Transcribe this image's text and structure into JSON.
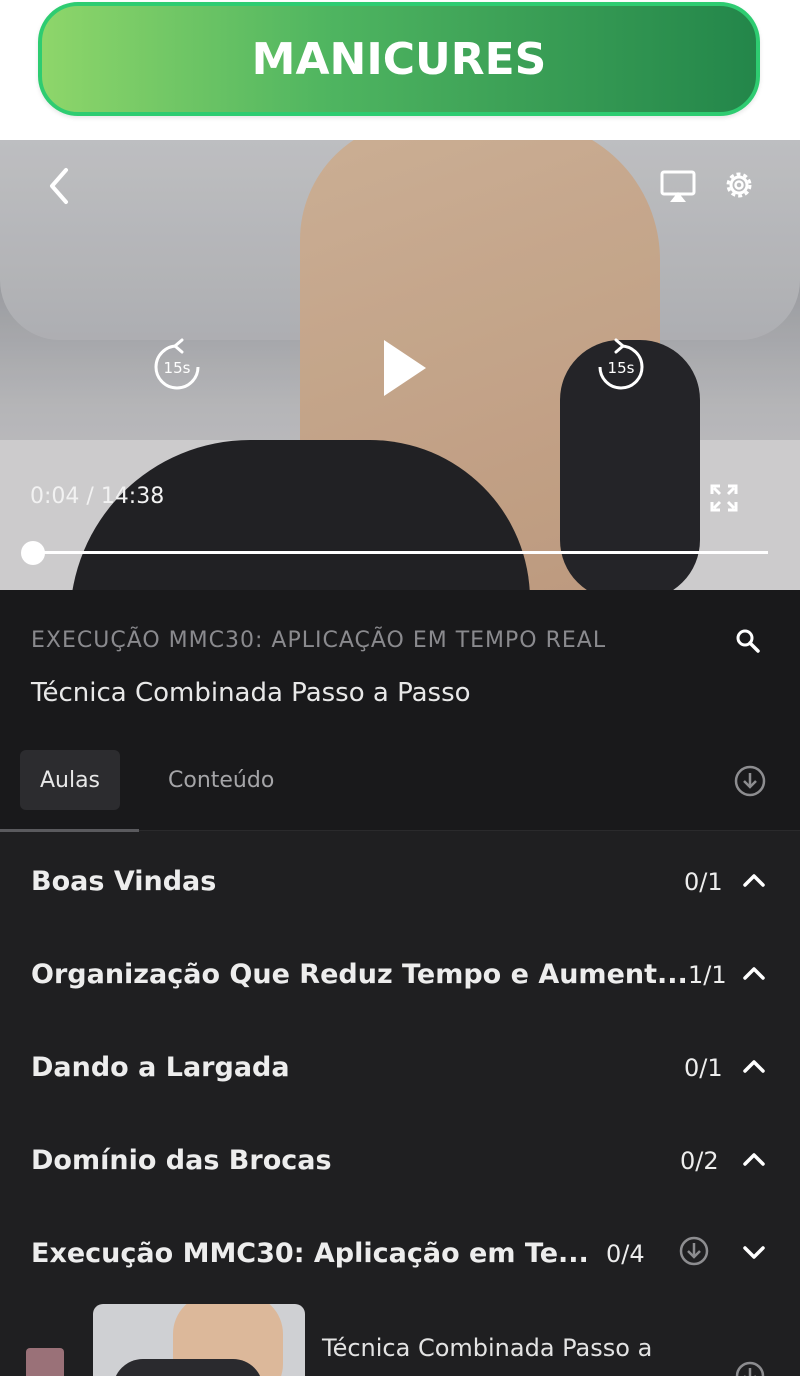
{
  "banner": {
    "title": "MANICURES"
  },
  "player": {
    "time_current": "0:04",
    "time_separator": " / ",
    "time_total": "14:38",
    "rewind_label": "15s",
    "forward_label": "15s",
    "progress": 0.005
  },
  "lesson": {
    "kicker": "EXECUÇÃO MMC30: APLICAÇÃO EM TEMPO REAL",
    "title": "Técnica Combinada Passo a Passo"
  },
  "tabs": [
    {
      "label": "Aulas",
      "active": true
    },
    {
      "label": "Conteúdo",
      "active": false
    }
  ],
  "modules": [
    {
      "title": "Boas Vindas",
      "count": "0/1",
      "expanded": false
    },
    {
      "title": "Organização Que Reduz Tempo e Aument...",
      "count": "1/1",
      "expanded": false
    },
    {
      "title": "Dando a Largada",
      "count": "0/1",
      "expanded": false
    },
    {
      "title": "Domínio das Brocas",
      "count": "0/2",
      "expanded": false
    },
    {
      "title": "Execução MMC30: Aplicação em Te...",
      "count": "0/4",
      "expanded": true
    }
  ],
  "lesson_item": {
    "title": "Técnica Combinada Passo a"
  },
  "colors": {
    "accent_green": "#2ecc71",
    "panel_bg": "#1f1f21"
  }
}
